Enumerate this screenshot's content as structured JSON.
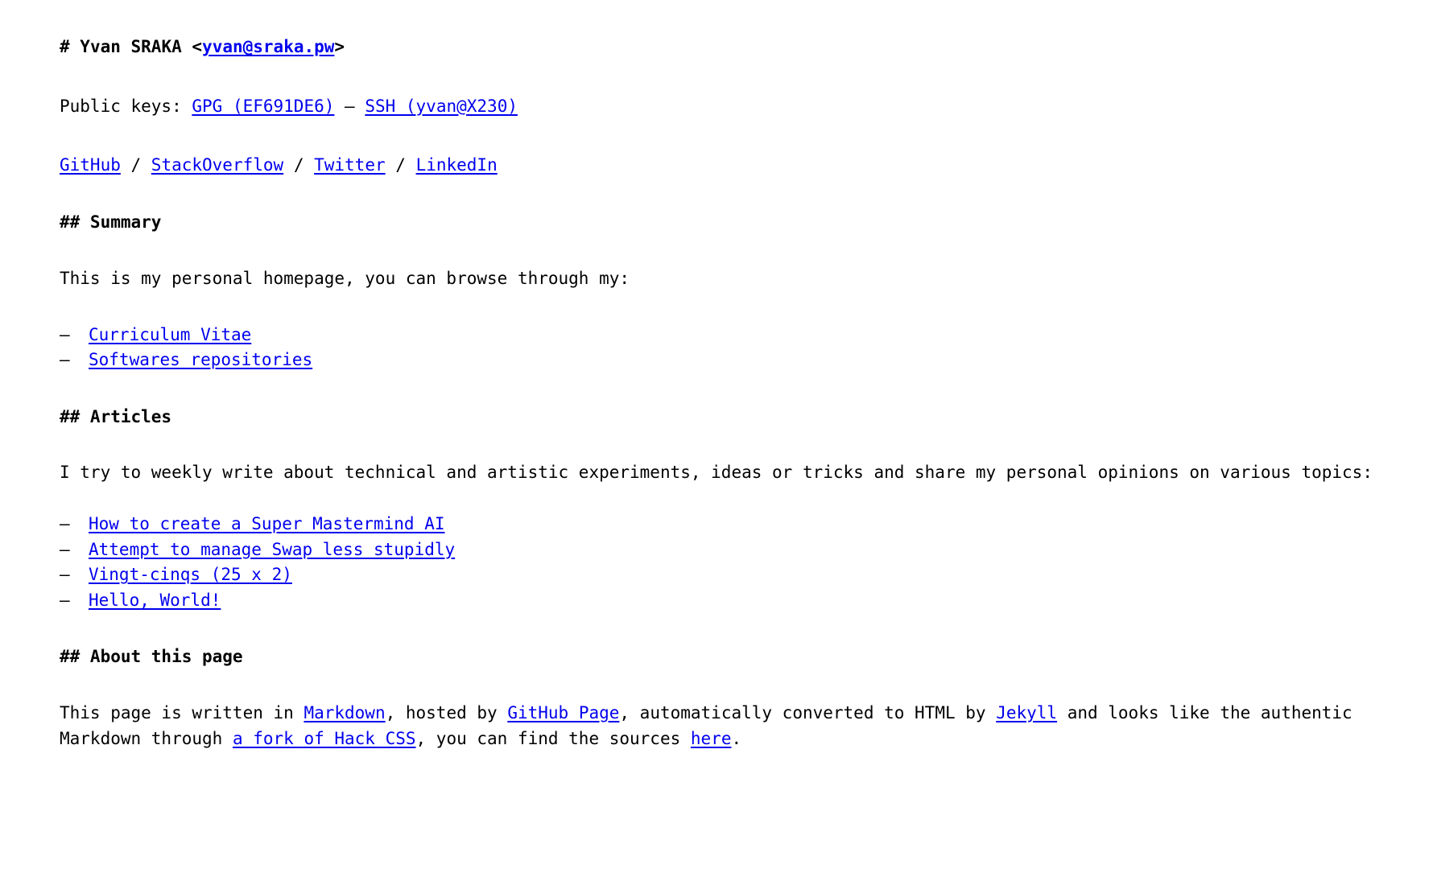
{
  "document": {
    "title_prefix": "# ",
    "title_name": "Yvan SRAKA",
    "title_bracket_open": "<",
    "title_email": "yvan@sraka.pw",
    "title_bracket_close": ">"
  },
  "keys_line": {
    "label": "Public keys: ",
    "gpg": "GPG (EF691DE6)",
    "separator": " — ",
    "ssh": "SSH (yvan@X230)"
  },
  "social_line": {
    "items": [
      {
        "label": "GitHub"
      },
      {
        "label": "StackOverflow"
      },
      {
        "label": "Twitter"
      },
      {
        "label": "LinkedIn"
      }
    ],
    "separator": " / "
  },
  "summary": {
    "heading": "## Summary",
    "paragraph": "This is my personal homepage, you can browse through my:",
    "bullet": "—",
    "items": [
      {
        "label": "Curriculum Vitae"
      },
      {
        "label": "Softwares repositories"
      }
    ]
  },
  "articles": {
    "heading": "## Articles",
    "paragraph": "I try to weekly write about technical and artistic experiments, ideas or tricks and share my personal opinions on various topics:",
    "bullet": "—",
    "items": [
      {
        "label": "How to create a Super Mastermind AI"
      },
      {
        "label": "Attempt to manage Swap less stupidly"
      },
      {
        "label": "Vingt-cinqs (25 x 2)"
      },
      {
        "label": "Hello, World!"
      }
    ]
  },
  "about": {
    "heading": "## About this page",
    "text_1": "This page is written in ",
    "link_markdown": "Markdown",
    "text_2": ", hosted by ",
    "link_github_page": "GitHub Page",
    "text_3": ", automatically converted to HTML by ",
    "link_jekyll": "Jekyll",
    "text_4": " and looks like the authentic Markdown through ",
    "link_hack_css": "a fork of Hack CSS",
    "text_5": ", you can find the sources ",
    "link_here": "here",
    "text_6": "."
  },
  "colors": {
    "link": "#0000ee",
    "text": "#000000",
    "background": "#ffffff"
  }
}
